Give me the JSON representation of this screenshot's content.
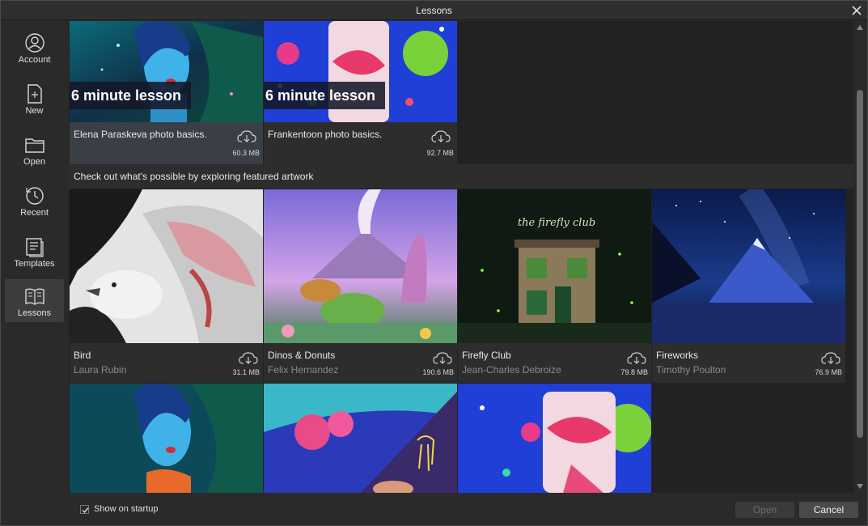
{
  "window": {
    "title": "Lessons"
  },
  "sidebar": {
    "items": [
      {
        "label": "Account",
        "icon": "account-icon"
      },
      {
        "label": "New",
        "icon": "new-document-icon"
      },
      {
        "label": "Open",
        "icon": "folder-icon"
      },
      {
        "label": "Recent",
        "icon": "clock-icon"
      },
      {
        "label": "Templates",
        "icon": "templates-icon"
      },
      {
        "label": "Lessons",
        "icon": "book-icon",
        "active": true
      }
    ]
  },
  "lessons": [
    {
      "badge": "6 minute lesson",
      "title": "Elena Paraskeva photo basics.",
      "size": "60.3 MB",
      "selected": true
    },
    {
      "badge": "6 minute lesson",
      "title": "Frankentoon photo basics.",
      "size": "92.7 MB"
    }
  ],
  "featured": {
    "heading": "Check out what's possible by exploring featured artwork",
    "items": [
      {
        "title": "Bird",
        "author": "Laura Rubin",
        "size": "31.1 MB"
      },
      {
        "title": "Dinos & Donuts",
        "author": "Felix Hernandez",
        "size": "190.6 MB"
      },
      {
        "title": "Firefly Club",
        "author": "Jean-Charles Debroize",
        "size": "79.8 MB",
        "sign": "the firefly club"
      },
      {
        "title": "Fireworks",
        "author": "Timothy Poulton",
        "size": "76.9 MB"
      }
    ]
  },
  "footer": {
    "show_on_startup": "Show on startup",
    "show_on_startup_checked": true,
    "open_label": "Open",
    "cancel_label": "Cancel"
  },
  "colors": {
    "accent_selected": "#3a3f47",
    "background": "#222222"
  }
}
